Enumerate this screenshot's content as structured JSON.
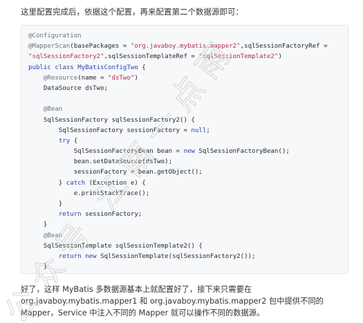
{
  "intro_text": "这里配置完成后，依据这个配置，再来配置第二个数据源即可：",
  "code": {
    "language": "java",
    "lines": [
      [
        [
          "ann",
          "@Configuration"
        ]
      ],
      [
        [
          "ann",
          "@MapperScan"
        ],
        [
          "pl",
          "(basePackages = "
        ],
        [
          "str",
          "\"org.javaboy.mybatis.mapper2\""
        ],
        [
          "pl",
          ",sqlSessionFactoryRef = "
        ]
      ],
      [
        [
          "str",
          "\"sqlSessionFactory2\""
        ],
        [
          "pl",
          ",sqlSessionTemplateRef = "
        ],
        [
          "str",
          "\"sqlSessionTemplate2\""
        ],
        [
          "pl",
          ")"
        ]
      ],
      [
        [
          "kw",
          "public"
        ],
        [
          "pl",
          " "
        ],
        [
          "kw",
          "class"
        ],
        [
          "pl",
          " "
        ],
        [
          "cls",
          "MyBatisConfigTwo"
        ],
        [
          "pl",
          " {"
        ]
      ],
      [
        [
          "pl",
          "    "
        ],
        [
          "ann",
          "@Resource"
        ],
        [
          "pl",
          "(name = "
        ],
        [
          "str",
          "\"dsTwo\""
        ],
        [
          "pl",
          ")"
        ]
      ],
      [
        [
          "pl",
          "    DataSource dsTwo;"
        ]
      ],
      [
        [
          "pl",
          ""
        ]
      ],
      [
        [
          "pl",
          "    "
        ],
        [
          "ann",
          "@Bean"
        ]
      ],
      [
        [
          "pl",
          "    SqlSessionFactory sqlSessionFactory2() {"
        ]
      ],
      [
        [
          "pl",
          "        SqlSessionFactory sessionFactory = "
        ],
        [
          "lit",
          "null"
        ],
        [
          "pl",
          ";"
        ]
      ],
      [
        [
          "pl",
          "        "
        ],
        [
          "kw",
          "try"
        ],
        [
          "pl",
          " {"
        ]
      ],
      [
        [
          "pl",
          "            SqlSessionFactoryBean bean = "
        ],
        [
          "kw",
          "new"
        ],
        [
          "pl",
          " SqlSessionFactoryBean();"
        ]
      ],
      [
        [
          "pl",
          "            bean.setDataSource(dsTwo);"
        ]
      ],
      [
        [
          "pl",
          "            sessionFactory = bean.getObject();"
        ]
      ],
      [
        [
          "pl",
          "        } "
        ],
        [
          "kw",
          "catch"
        ],
        [
          "pl",
          " (Exception e) {"
        ]
      ],
      [
        [
          "pl",
          "            e.printStackTrace();"
        ]
      ],
      [
        [
          "pl",
          "        }"
        ]
      ],
      [
        [
          "pl",
          "        "
        ],
        [
          "kw",
          "return"
        ],
        [
          "pl",
          " sessionFactory;"
        ]
      ],
      [
        [
          "pl",
          "    }"
        ]
      ],
      [
        [
          "pl",
          "    "
        ],
        [
          "ann",
          "@Bean"
        ]
      ],
      [
        [
          "pl",
          "    SqlSessionTemplate sqlSessionTemplate2() {"
        ]
      ],
      [
        [
          "pl",
          "        "
        ],
        [
          "kw",
          "return"
        ],
        [
          "pl",
          " "
        ],
        [
          "kw",
          "new"
        ],
        [
          "pl",
          " SqlSessionTemplate(sqlSessionFactory2());"
        ]
      ],
      [
        [
          "pl",
          "    }"
        ]
      ],
      [
        [
          "pl",
          "}"
        ]
      ]
    ]
  },
  "outro_text": "好了，这样 MyBatis 多数据源基本上就配置好了，接下来只需要在 org.javaboy.mybatis.mapper1 和 org.javaboy.mybatis.mapper2 包中提供不同的 Mapper，Service 中注入不同的 Mapper 就可以操作不同的数据源。",
  "watermark_text": "公众号 江南一点雨",
  "colors": {
    "code_background": "#f6f8fa",
    "keyword": "#2a3fb0",
    "string": "#b32f4d",
    "annotation": "#6a737d"
  }
}
